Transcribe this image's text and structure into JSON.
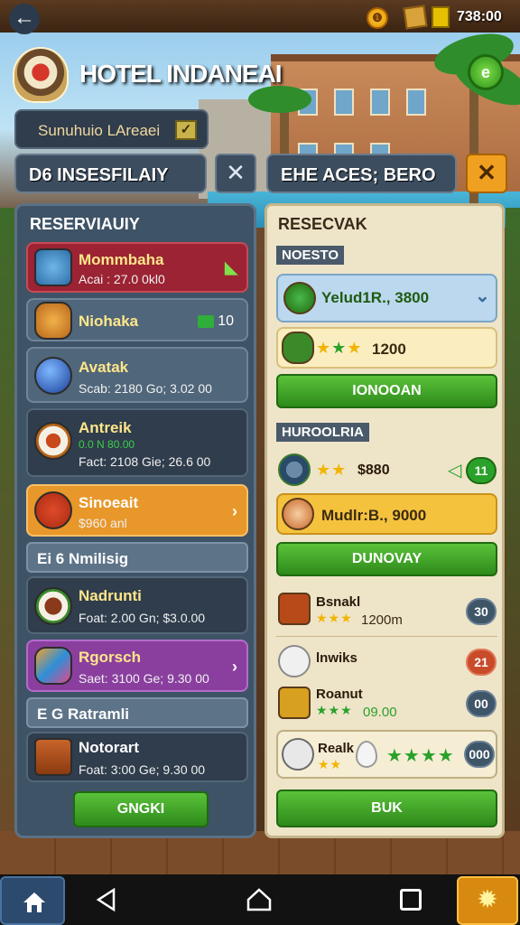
{
  "header": {
    "back_icon": "←",
    "coin_symbol": "❶",
    "money": "738:00",
    "title": "HOTEL INDANEAI",
    "badge_symbol": "e"
  },
  "filters": {
    "sub_label": "Sunuhuio LAreaei",
    "sub_check": "✓",
    "left_label": "D6 INSESFILAIY",
    "left_close": "✕",
    "right_label": "EHE ACES; BERO",
    "right_close": "✕"
  },
  "left_panel": {
    "title": "RESERVIAUIY",
    "cards": [
      {
        "title": "Mommbaha",
        "sub": "Acai : 27.0 0kl0"
      },
      {
        "title": "Niohaka",
        "tag": "10"
      },
      {
        "title": "Avatak",
        "sub": "Scab: 2180 Go; 3.02 00"
      },
      {
        "title": "Antreik",
        "sub_green": "0.0 N 80.00",
        "sub": "Fact: 2108 Gie; 26.6 00"
      },
      {
        "title": "Sinoeait",
        "sub": "$960 anl",
        "arrow": "›"
      }
    ],
    "section1": "Ei 6 Nmilisig",
    "cards2": [
      {
        "title": "Nadrunti",
        "sub": "Foat: 2.00 Gn; $3.0.00"
      },
      {
        "title": "Rgorsch",
        "sub": "Saet: 3100 Ge; 9.30 00",
        "arrow": "›"
      }
    ],
    "section2": "E G Ratramli",
    "cards3": [
      {
        "title": "Notorart",
        "sub": "Foat: 3:00 Ge; 9.30 00"
      }
    ],
    "button": "GNGKI"
  },
  "right_panel": {
    "title": "RESECVAK",
    "section1": "NOESTO",
    "blue_row": "Yelud1R., 3800",
    "blue_chevron": "⌄",
    "yellow_row": "1200",
    "button1": "IONOOAN",
    "section2": "HUROOLRIA",
    "row_price": "$880",
    "row_tag": "11",
    "gold_row": "Mudlr:B., 9000",
    "button2": "DUNOVAY",
    "items": [
      {
        "name": "Bsnakl",
        "value": "1200m",
        "badge": "30"
      },
      {
        "name": "lnwiks",
        "badge": "21"
      },
      {
        "name": "Roanut",
        "value": "09.00",
        "badge": "00"
      },
      {
        "name": "Realk",
        "badge": "000"
      }
    ],
    "button3": "BUK"
  },
  "colors": {
    "accent_green": "#2e8a1a",
    "panel_blue": "#3e5366",
    "panel_cream": "#eee4c8",
    "orange": "#f0a020"
  }
}
